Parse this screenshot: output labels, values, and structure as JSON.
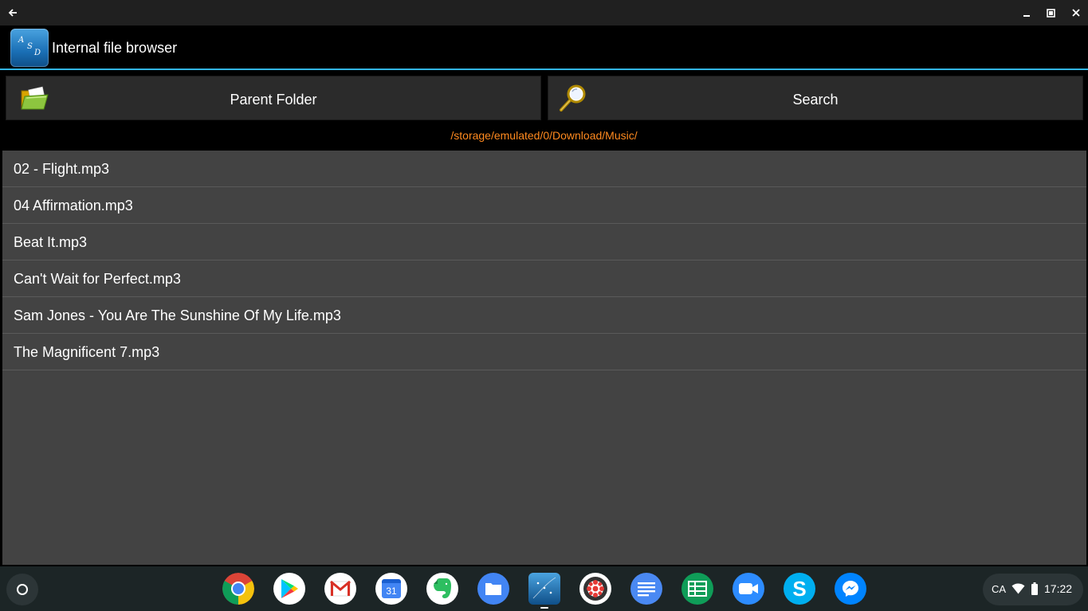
{
  "window": {
    "back_icon": "arrow-left-icon",
    "minimize_icon": "minimize-icon",
    "maximize_icon": "restore-icon",
    "close_icon": "close-icon"
  },
  "app": {
    "title": "Internal file browser",
    "logo_letters": [
      "A",
      "S",
      "D"
    ],
    "accent_color": "#33b5e5"
  },
  "toolbar": {
    "parent_label": "Parent Folder",
    "parent_icon": "open-folder-icon",
    "search_label": "Search",
    "search_icon": "magnifier-icon"
  },
  "path": {
    "text": "/storage/emulated/0/Download/Music/",
    "color": "#ff8a1f"
  },
  "files": [
    {
      "name": "02 - Flight.mp3"
    },
    {
      "name": "04 Affirmation.mp3"
    },
    {
      "name": "Beat It.mp3"
    },
    {
      "name": "Can't Wait for Perfect.mp3"
    },
    {
      "name": "Sam Jones - You Are The Sunshine Of My Life.mp3"
    },
    {
      "name": "The Magnificent 7.mp3"
    }
  ],
  "shelf": {
    "apps": [
      {
        "name": "chrome-icon"
      },
      {
        "name": "play-store-icon"
      },
      {
        "name": "gmail-icon"
      },
      {
        "name": "calendar-icon",
        "text": "31"
      },
      {
        "name": "evernote-icon"
      },
      {
        "name": "files-icon"
      },
      {
        "name": "asd-app-icon"
      },
      {
        "name": "aperture-app-icon"
      },
      {
        "name": "docs-icon"
      },
      {
        "name": "sheets-icon"
      },
      {
        "name": "zoom-icon"
      },
      {
        "name": "skype-icon",
        "text": "S"
      },
      {
        "name": "messenger-icon"
      }
    ],
    "tray": {
      "lang": "CA",
      "time": "17:22"
    }
  }
}
